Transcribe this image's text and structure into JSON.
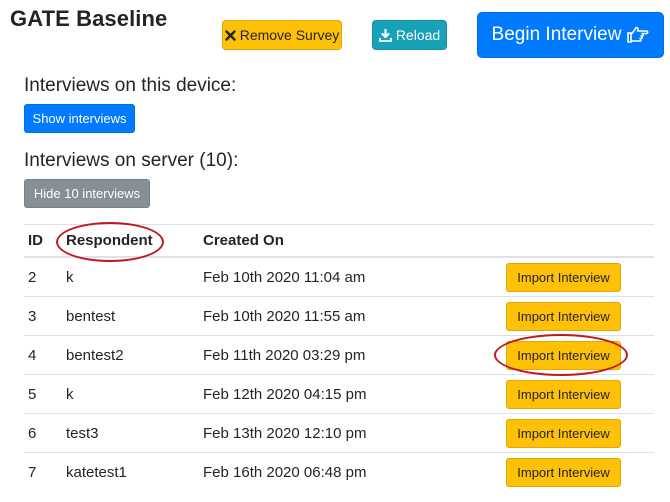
{
  "header": {
    "title": "GATE Baseline",
    "remove_label": "Remove Survey",
    "reload_label": "Reload",
    "begin_label": "Begin Interview"
  },
  "device_section": {
    "heading": "Interviews on this device:",
    "show_label": "Show interviews"
  },
  "server_section": {
    "heading": "Interviews on server (10):",
    "hide_label": "Hide 10 interviews"
  },
  "table": {
    "columns": [
      "ID",
      "Respondent",
      "Created On"
    ],
    "rows": [
      {
        "id": "2",
        "respondent": "k",
        "created": "Feb 10th 2020 11:04 am",
        "action": "Import Interview"
      },
      {
        "id": "3",
        "respondent": "bentest",
        "created": "Feb 10th 2020 11:55 am",
        "action": "Import Interview"
      },
      {
        "id": "4",
        "respondent": "bentest2",
        "created": "Feb 11th 2020 03:29 pm",
        "action": "Import Interview"
      },
      {
        "id": "5",
        "respondent": "k",
        "created": "Feb 12th 2020 04:15 pm",
        "action": "Import Interview"
      },
      {
        "id": "6",
        "respondent": "test3",
        "created": "Feb 13th 2020 12:10 pm",
        "action": "Import Interview"
      },
      {
        "id": "7",
        "respondent": "katetest1",
        "created": "Feb 16th 2020 06:48 pm",
        "action": "Import Interview"
      }
    ]
  },
  "colors": {
    "warning": "#ffc107",
    "info": "#17a2b8",
    "primary": "#007bff",
    "secondary": "#868e96",
    "annotation": "#c0181f"
  },
  "icons": {
    "remove": "close-icon",
    "reload": "download-icon",
    "begin": "hand-point-right-icon"
  }
}
